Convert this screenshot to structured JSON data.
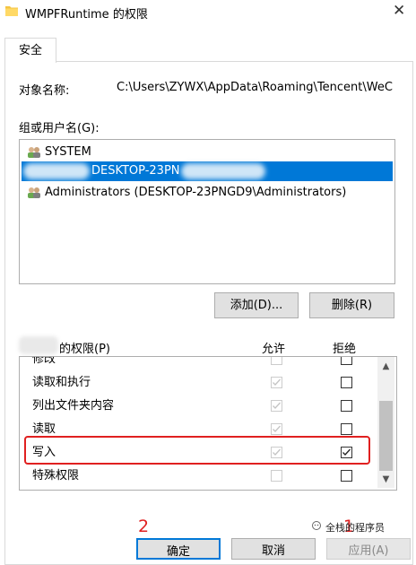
{
  "window": {
    "title": "WMPFRuntime 的权限",
    "close": "✕"
  },
  "tabs": [
    {
      "label": "安全"
    }
  ],
  "object": {
    "label": "对象名称:",
    "value": "C:\\Users\\ZYWX\\AppData\\Roaming\\Tencent\\WeC"
  },
  "groups": {
    "label": "组或用户名(G):",
    "items": [
      {
        "label": "SYSTEM"
      },
      {
        "label": "DESKTOP-23PN"
      },
      {
        "label": "Administrators (DESKTOP-23PNGD9\\Administrators)"
      }
    ]
  },
  "buttons": {
    "add": "添加(D)...",
    "remove": "删除(R)"
  },
  "permissions": {
    "label": "的权限(P)",
    "allow_header": "允许",
    "deny_header": "拒绝",
    "rows": [
      {
        "name": "修改",
        "allow": false,
        "deny": false
      },
      {
        "name": "读取和执行",
        "allow": true,
        "deny": false
      },
      {
        "name": "列出文件夹内容",
        "allow": true,
        "deny": false
      },
      {
        "name": "读取",
        "allow": true,
        "deny": false
      },
      {
        "name": "写入",
        "allow": true,
        "deny": true
      },
      {
        "name": "特殊权限",
        "allow": false,
        "deny": false
      }
    ]
  },
  "annotations": {
    "step2": "2",
    "step1": "1"
  },
  "footer": {
    "ok": "确定",
    "cancel": "取消",
    "apply": "应用(A)"
  },
  "watermark": "全栈的程序员",
  "colors": {
    "selection": "#0078d7",
    "highlight": "#e02020",
    "button_bg": "#e1e1e1"
  }
}
